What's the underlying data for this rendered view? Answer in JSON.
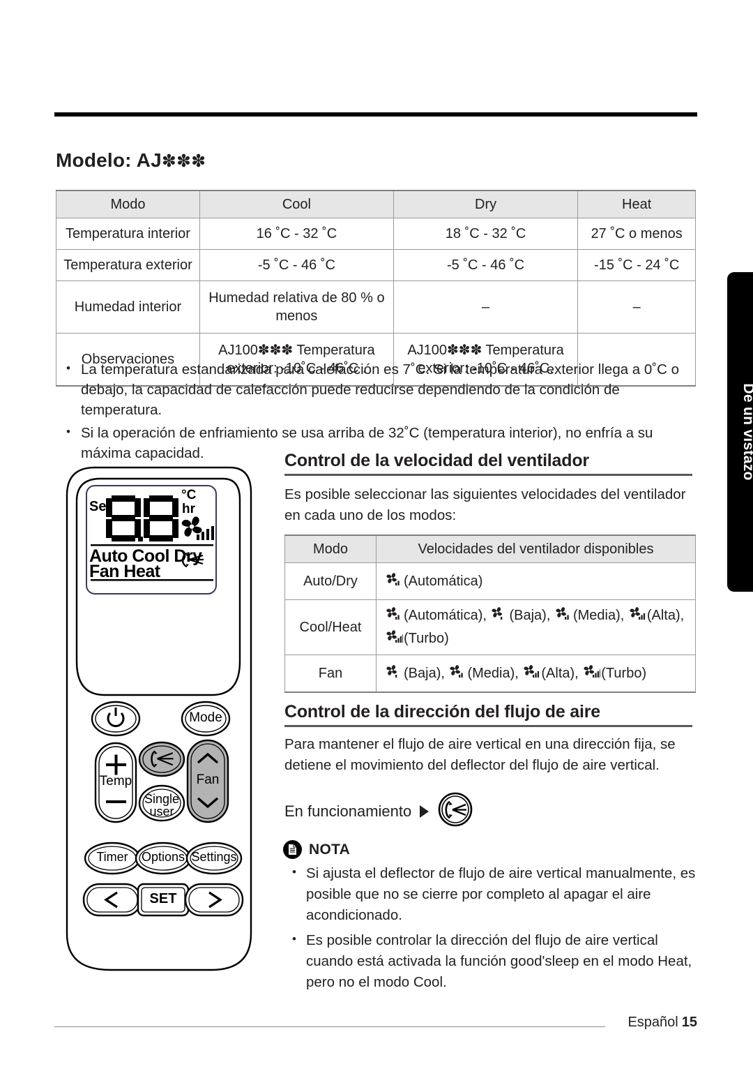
{
  "page": {
    "footer_language": "Español",
    "footer_page_number": "15",
    "side_tab_label": "De un vistazo"
  },
  "model_section": {
    "title_prefix": "Modelo: AJ",
    "title_stars": "✽✽✽",
    "table": {
      "headers": [
        "Modo",
        "Cool",
        "Dry",
        "Heat"
      ],
      "rows": [
        {
          "label": "Temperatura interior",
          "cool": "16 ˚C - 32 ˚C",
          "dry": "18 ˚C - 32 ˚C",
          "heat": "27 ˚C o menos"
        },
        {
          "label": "Temperatura exterior",
          "cool": "-5 ˚C - 46 ˚C",
          "dry": "-5 ˚C - 46 ˚C",
          "heat": "-15 ˚C - 24 ˚C"
        },
        {
          "label": "Humedad interior",
          "cool": "Humedad relativa de 80 % o menos",
          "dry": "–",
          "heat": "–"
        },
        {
          "label": "Observaciones",
          "cool": "AJ100✽✽✽ Temperatura exterior: -10˚C - 46˚C .",
          "dry": "AJ100✽✽✽ Temperatura exterior: -10˚C - 46˚C.",
          "heat": ""
        }
      ]
    },
    "bullets": [
      "La temperatura estandarizada para calefacción es 7˚C. Si la temperatura exterior llega a 0˚C o debajo, la capacidad de calefacción puede reducirse dependiendo de la condición de temperatura.",
      "Si la operación de enfriamiento se usa arriba de 32˚C (temperatura interior), no enfría a su máxima capacidad."
    ]
  },
  "fan_speed_section": {
    "heading": "Control de la velocidad del ventilador",
    "intro": "Es posible seleccionar las siguientes velocidades del ventilador en cada uno de los modos:",
    "table": {
      "headers": [
        "Modo",
        "Velocidades del ventilador disponibles"
      ],
      "rows": [
        {
          "mode": "Auto/Dry",
          "speeds": [
            {
              "icon": "fan-auto-icon",
              "bars": 2,
              "label": "(Automática)"
            }
          ]
        },
        {
          "mode": "Cool/Heat",
          "speeds": [
            {
              "icon": "fan-auto-icon",
              "bars": 2,
              "label": "(Automática),"
            },
            {
              "icon": "fan-low-icon",
              "bars": 1,
              "label": "(Baja),"
            },
            {
              "icon": "fan-medium-icon",
              "bars": 2,
              "label": "(Media),"
            },
            {
              "icon": "fan-high-icon",
              "bars": 3,
              "label": "(Alta),"
            },
            {
              "icon": "fan-turbo-icon",
              "bars": 4,
              "label": "(Turbo)"
            }
          ]
        },
        {
          "mode": "Fan",
          "speeds": [
            {
              "icon": "fan-low-icon",
              "bars": 1,
              "label": "(Baja),"
            },
            {
              "icon": "fan-medium-icon",
              "bars": 2,
              "label": "(Media),"
            },
            {
              "icon": "fan-high-icon",
              "bars": 3,
              "label": "(Alta),"
            },
            {
              "icon": "fan-turbo-icon",
              "bars": 4,
              "label": "(Turbo)"
            }
          ]
        }
      ]
    }
  },
  "airflow_section": {
    "heading": "Control de la dirección del flujo de aire",
    "intro": "Para mantener el flujo de aire vertical en una dirección fija, se detiene el movimiento del deflector del flujo de aire vertical.",
    "operating_label": "En funcionamiento",
    "note": {
      "title": "NOTA",
      "bullets": [
        "Si ajusta el deflector de flujo de aire vertical manualmente, es posible que no se cierre por completo al apagar el aire acondicionado.",
        "Es posible controlar la dirección del flujo de aire vertical cuando está activada la función good'sleep en el modo Heat, pero no el modo Cool."
      ]
    }
  },
  "remote": {
    "display": {
      "set_label": "Set",
      "digits": "88",
      "unit_c": "°C",
      "unit_hr": "hr",
      "modes_row1": "Auto Cool Dry",
      "modes_row2": "Fan   Heat"
    },
    "buttons": [
      {
        "name": "power-button",
        "label": ""
      },
      {
        "name": "mode-button",
        "label": "Mode"
      },
      {
        "name": "temp-up-button",
        "label": "+"
      },
      {
        "name": "temp-label",
        "label": "Temp"
      },
      {
        "name": "temp-down-button",
        "label": "−"
      },
      {
        "name": "airflow-direction-button",
        "label": ""
      },
      {
        "name": "single-user-button",
        "label": "Single user"
      },
      {
        "name": "fan-button",
        "label": "Fan"
      },
      {
        "name": "timer-button",
        "label": "Timer"
      },
      {
        "name": "options-button",
        "label": "Options"
      },
      {
        "name": "settings-button",
        "label": "Settings"
      },
      {
        "name": "prev-button",
        "label": "‹"
      },
      {
        "name": "set-button",
        "label": "SET"
      },
      {
        "name": "next-button",
        "label": "›"
      }
    ]
  },
  "colors": {
    "ink": "#231f20",
    "table_header_bg": "#e6e6e6",
    "table_border": "#9a9a9a",
    "tab_bg": "#000000",
    "button_gray": "#b3b3b3"
  }
}
